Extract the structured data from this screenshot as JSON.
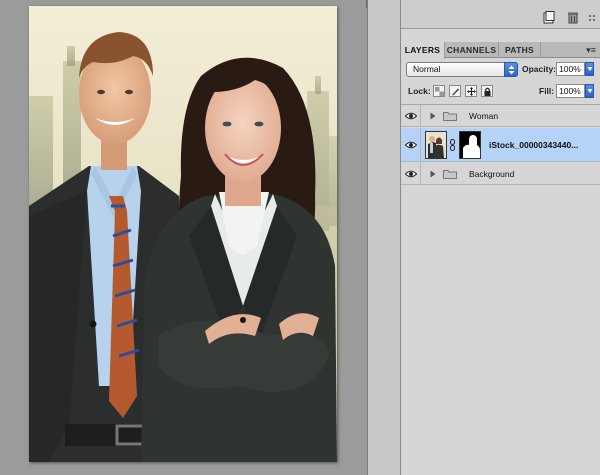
{
  "panel": {
    "tabs": [
      {
        "label": "LAYERS",
        "active": true
      },
      {
        "label": "CHANNELS",
        "active": false
      },
      {
        "label": "PATHS",
        "active": false
      }
    ],
    "menu_glyph": "▾≡",
    "blend_mode": "Normal",
    "opacity_label": "Opacity:",
    "opacity_value": "100%",
    "lock_label": "Lock:",
    "fill_label": "Fill:",
    "fill_value": "100%"
  },
  "layers": [
    {
      "name": "Woman",
      "type": "group",
      "visible": true,
      "selected": false
    },
    {
      "name": "iStock_00000343440...",
      "type": "smart-object-with-mask",
      "visible": true,
      "selected": true
    },
    {
      "name": "Background",
      "type": "group",
      "visible": true,
      "selected": false
    }
  ],
  "colors": {
    "selection": "#b5d2f7",
    "accent_blue": "#2c62c8",
    "panel_bg": "#d6d6d6",
    "canvas_bg": "#9b9b9b"
  },
  "icons": {
    "topbar": [
      "new-layer-icon",
      "trash-icon"
    ],
    "locks": [
      "lock-transparent-pixels-icon",
      "lock-image-pixels-icon",
      "lock-position-icon",
      "lock-all-icon"
    ],
    "row": [
      "eye-icon",
      "disclosure-triangle-icon",
      "folder-icon",
      "chain-link-icon"
    ]
  }
}
